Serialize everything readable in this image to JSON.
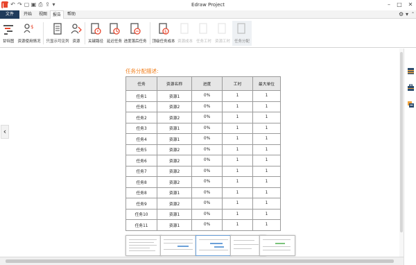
{
  "window": {
    "title": "Edraw Project"
  },
  "quick_access": [
    "undo-icon",
    "redo-icon",
    "open-icon",
    "save-icon",
    "print-icon",
    "export-icon",
    "more-icon"
  ],
  "tabs": {
    "file": "文件",
    "start": "开始",
    "view": "视图",
    "report": "报告",
    "help": "帮助",
    "active": "报告"
  },
  "ribbon": {
    "gantt": "甘特图",
    "resource_usage": "资源使用情况",
    "visible_only": "只显示可见列",
    "resource": "资源",
    "critical_path": "关键路径",
    "overdue_tasks": "延迟任务",
    "progress_tasks": "进度落后任务",
    "top_task_cost": "顶级任务成本",
    "resource_cost": "资源成本",
    "task_work": "任务工时",
    "resource_work": "资源工时",
    "task_assign": "任务分配"
  },
  "report": {
    "title": "任务分配描述:",
    "columns": [
      "任务",
      "资源名称",
      "进度",
      "工时",
      "最大单位"
    ],
    "rows": [
      [
        "任务1",
        "资源1",
        "0%",
        "1",
        "1"
      ],
      [
        "任务1",
        "资源2",
        "0%",
        "1",
        "1"
      ],
      [
        "任务2",
        "资源2",
        "0%",
        "1",
        "1"
      ],
      [
        "任务3",
        "资源1",
        "0%",
        "1",
        "1"
      ],
      [
        "任务4",
        "资源1",
        "0%",
        "1",
        "1"
      ],
      [
        "任务5",
        "资源2",
        "0%",
        "1",
        "1"
      ],
      [
        "任务6",
        "资源2",
        "0%",
        "1",
        "1"
      ],
      [
        "任务7",
        "资源2",
        "0%",
        "1",
        "1"
      ],
      [
        "任务8",
        "资源2",
        "0%",
        "1",
        "1"
      ],
      [
        "任务8",
        "资源1",
        "0%",
        "1",
        "1"
      ],
      [
        "任务9",
        "资源2",
        "0%",
        "1",
        "1"
      ],
      [
        "任务10",
        "资源1",
        "0%",
        "1",
        "1"
      ],
      [
        "任务11",
        "资源1",
        "0%",
        "1",
        "1"
      ]
    ]
  },
  "colors": {
    "accent_orange": "#f07d1a",
    "file_tab": "#1f3b5c",
    "icon_red": "#e8452c"
  }
}
